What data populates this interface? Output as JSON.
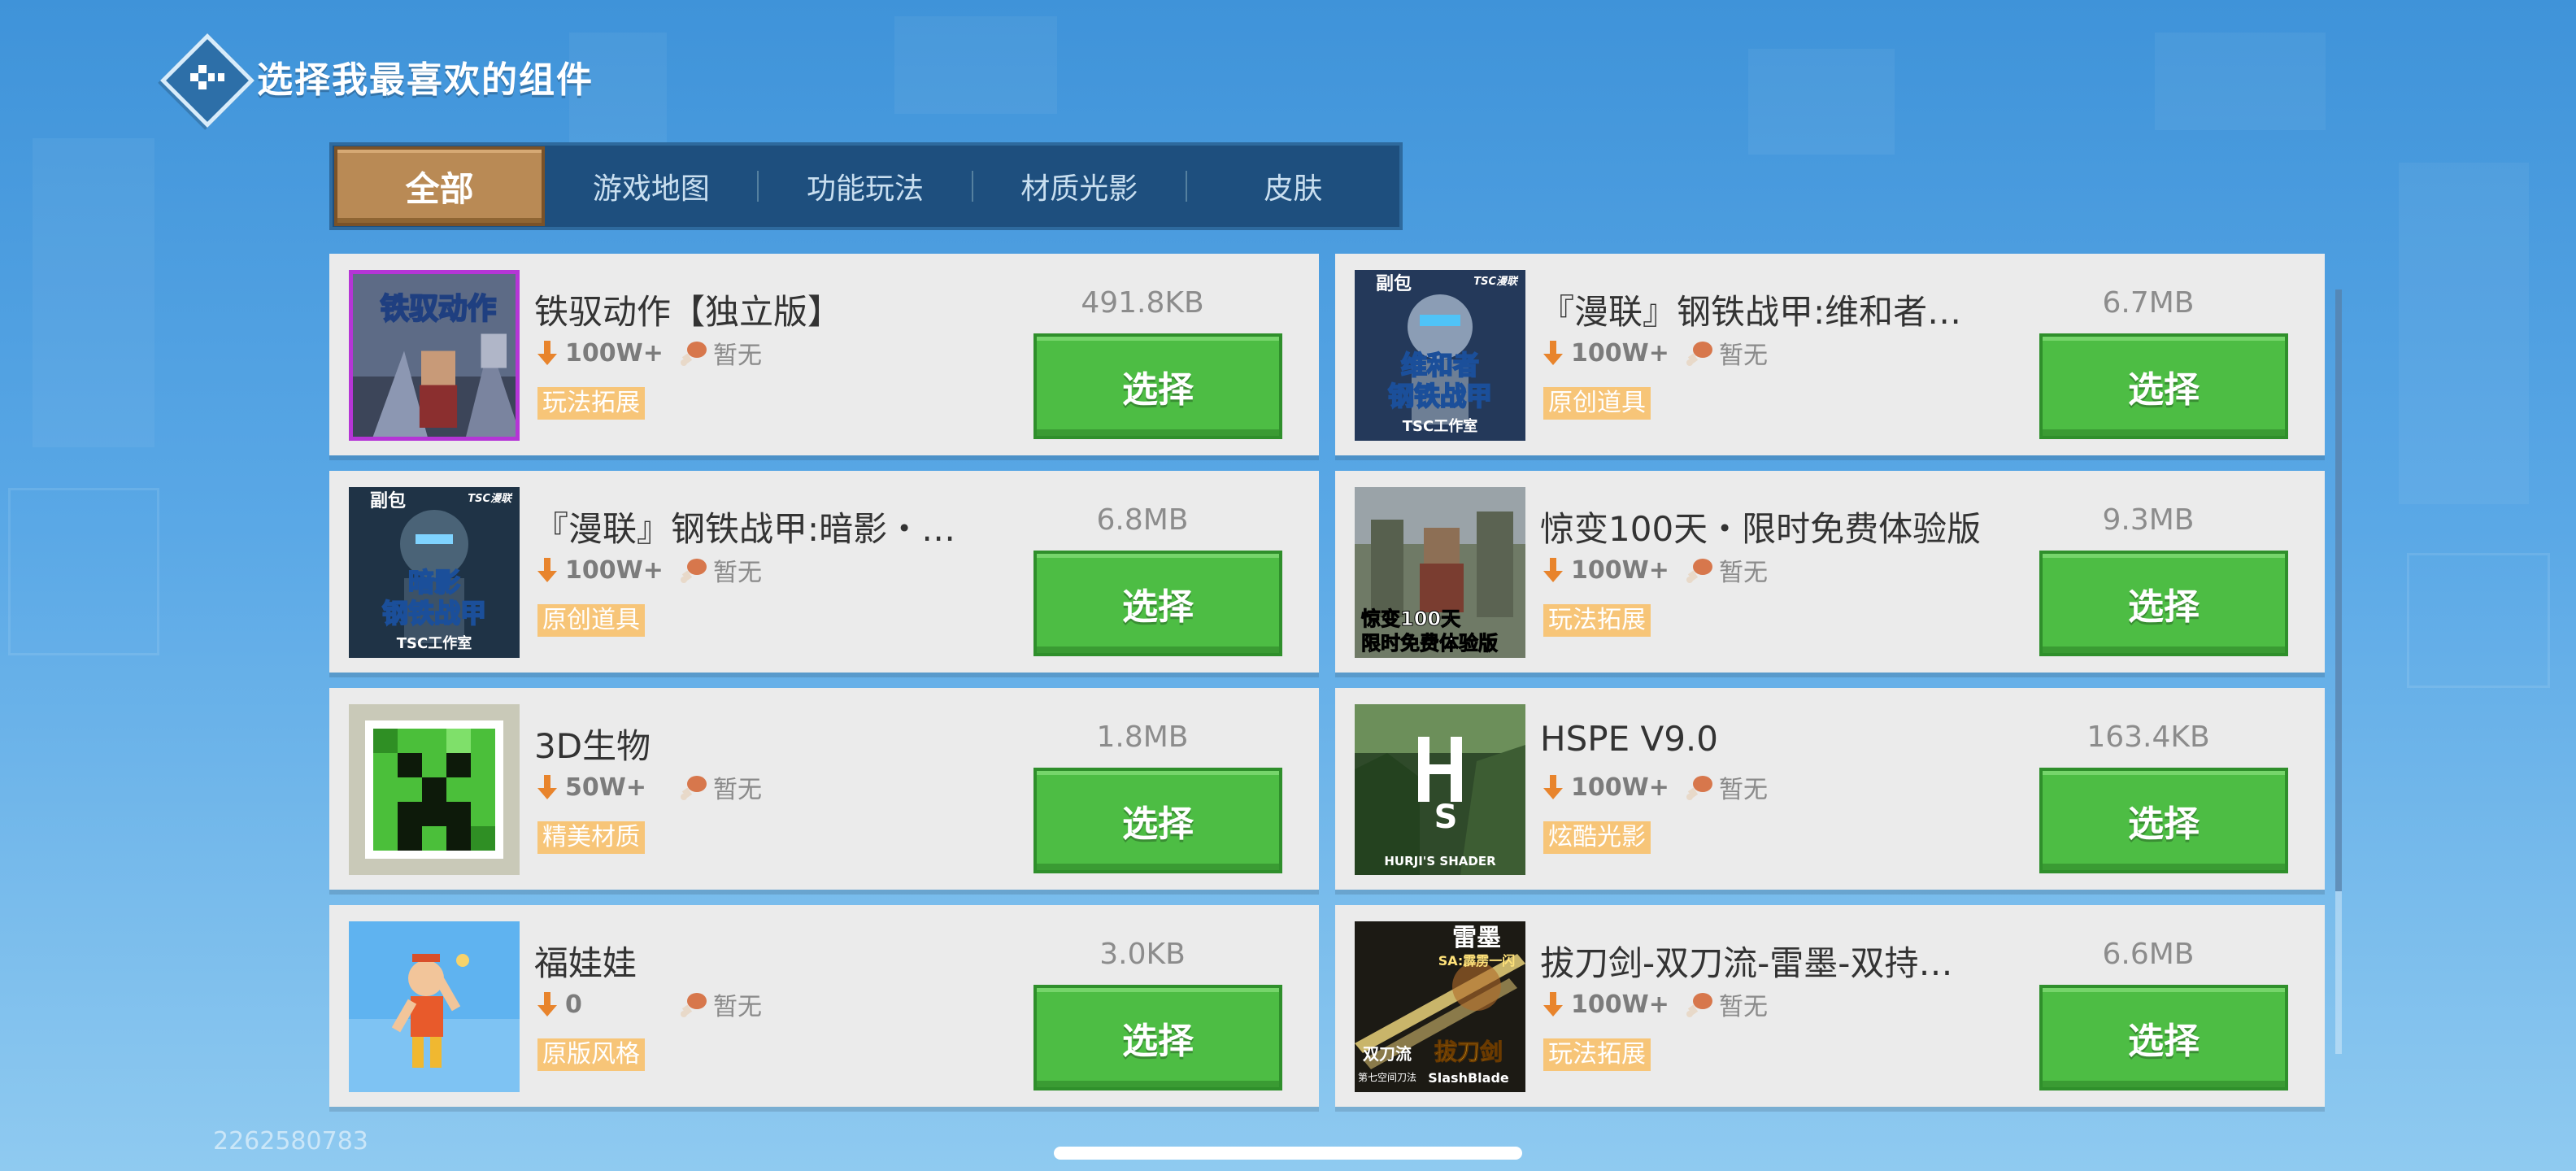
{
  "header": {
    "title": "选择我最喜欢的组件"
  },
  "tabs": [
    {
      "label": "全部",
      "active": true
    },
    {
      "label": "游戏地图",
      "active": false
    },
    {
      "label": "功能玩法",
      "active": false
    },
    {
      "label": "材质光影",
      "active": false
    },
    {
      "label": "皮肤",
      "active": false
    }
  ],
  "items": [
    {
      "title": "铁驭动作【独立版】",
      "downloads": "100W+",
      "rating": "暂无",
      "tag": "玩法拓展",
      "size": "491.8KB",
      "button": "选择",
      "thumb_text": "铁驭动作"
    },
    {
      "title": "『漫联』钢铁战甲:维和者…",
      "downloads": "100W+",
      "rating": "暂无",
      "tag": "原创道具",
      "size": "6.7MB",
      "button": "选择",
      "thumb_text": [
        "副包",
        "TSC漫联",
        "维和者",
        "钢铁战甲",
        "TSC工作室"
      ]
    },
    {
      "title": "『漫联』钢铁战甲:暗影・…",
      "downloads": "100W+",
      "rating": "暂无",
      "tag": "原创道具",
      "size": "6.8MB",
      "button": "选择",
      "thumb_text": [
        "副包",
        "TSC漫联",
        "暗影",
        "钢铁战甲",
        "TSC工作室"
      ]
    },
    {
      "title": "惊变100天・限时免费体验版",
      "downloads": "100W+",
      "rating": "暂无",
      "tag": "玩法拓展",
      "size": "9.3MB",
      "button": "选择",
      "thumb_text": [
        "惊变100天",
        "限时免费体验版"
      ]
    },
    {
      "title": "3D生物",
      "downloads": "50W+",
      "rating": "暂无",
      "tag": "精美材质",
      "size": "1.8MB",
      "button": "选择"
    },
    {
      "title": "HSPE V9.0",
      "downloads": "100W+",
      "rating": "暂无",
      "tag": "炫酷光影",
      "size": "163.4KB",
      "button": "选择",
      "thumb_text": [
        "HURJI'S SHADER"
      ]
    },
    {
      "title": "福娃娃",
      "downloads": "0",
      "rating": "暂无",
      "tag": "原版风格",
      "size": "3.0KB",
      "button": "选择"
    },
    {
      "title": "拔刀剑-双刀流-雷墨-双持…",
      "downloads": "100W+",
      "rating": "暂无",
      "tag": "玩法拓展",
      "size": "6.6MB",
      "button": "选择",
      "thumb_text": [
        "雷墨",
        "SA:霹雳一闪",
        "双刀流",
        "拔刀剑",
        "第七空间刀法",
        "SlashBlade"
      ]
    }
  ],
  "footer": {
    "id_text": "2262580783"
  },
  "colors": {
    "select_green": "#4dbd44",
    "tab_active": "#b98a55",
    "tag_orange": "#f7c578"
  }
}
